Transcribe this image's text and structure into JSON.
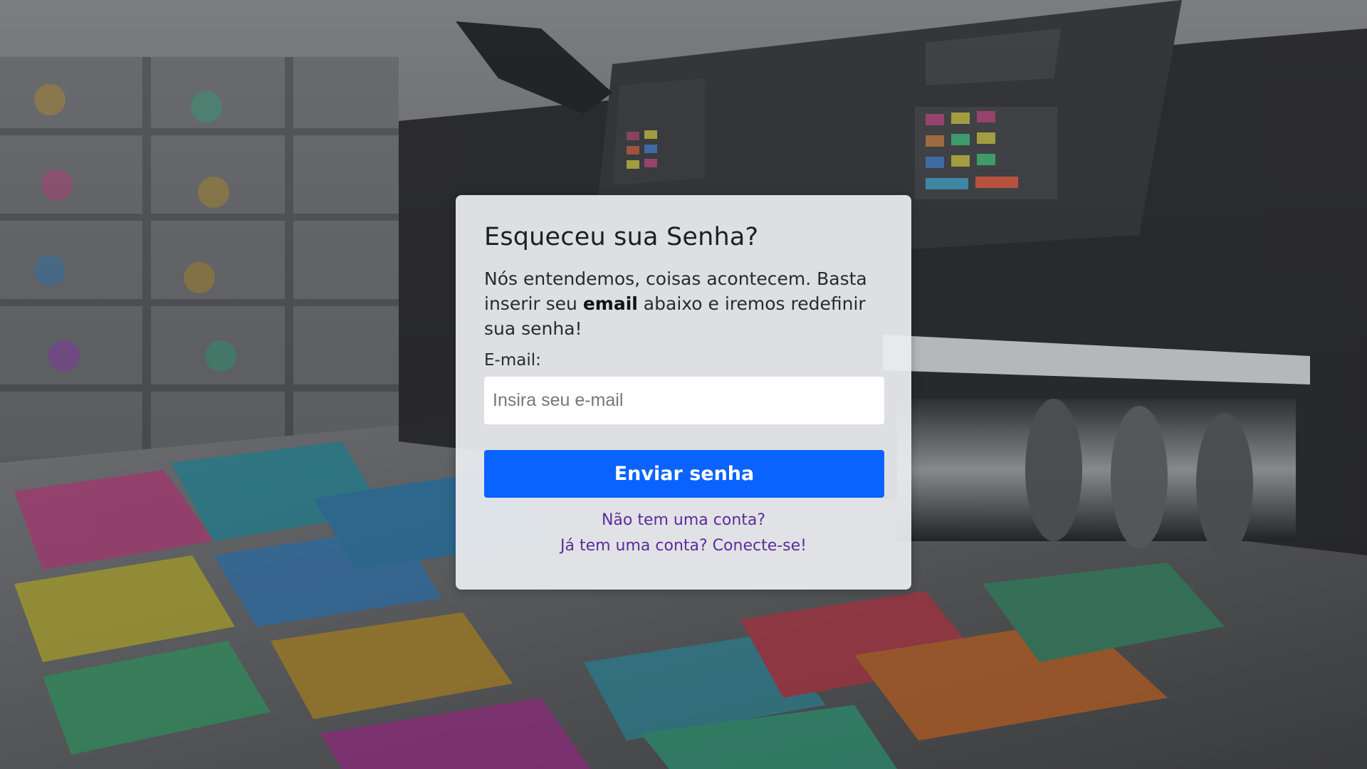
{
  "card": {
    "title": "Esqueceu sua Senha?",
    "description_before": "Nós entendemos, coisas acontecem. Basta inserir seu ",
    "description_bold": "email",
    "description_after": " abaixo e iremos redefinir sua senha!",
    "email_label": "E-mail:",
    "email_placeholder": "Insira seu e-mail",
    "email_value": "",
    "submit_label": "Enviar senha",
    "signup_link": "Não tem uma conta?",
    "login_link": "Já tem uma conta? Conecte-se!"
  },
  "colors": {
    "primary_button": "#0a63ff",
    "link": "#5b2b9e",
    "card_background": "#ecedf0"
  }
}
